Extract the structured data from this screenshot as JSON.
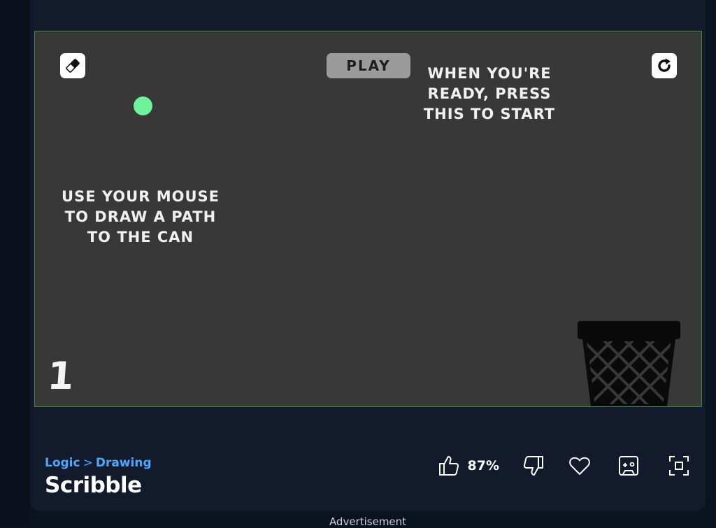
{
  "game": {
    "play_label": "PLAY",
    "hint_right": [
      "WHEN YOU'RE",
      "READY, PRESS",
      "THIS TO START"
    ],
    "hint_left": [
      "USE YOUR MOUSE",
      "TO DRAW A PATH",
      "TO THE CAN"
    ],
    "level_number": "1",
    "eraser_icon": "eraser-icon",
    "restart_icon": "restart-icon",
    "colors": {
      "canvas_bg": "#383838",
      "ball": "#6ef39b",
      "frame_border": "#3a8c34"
    }
  },
  "info": {
    "breadcrumb": {
      "category": "Logic",
      "separator": ">",
      "subcategory": "Drawing"
    },
    "title": "Scribble",
    "rating_percent": "87%",
    "actions": [
      "thumbs-up-icon",
      "thumbs-down-icon",
      "heart-icon",
      "gamepad-icon",
      "fullscreen-icon"
    ]
  },
  "ad_label": "Advertisement"
}
